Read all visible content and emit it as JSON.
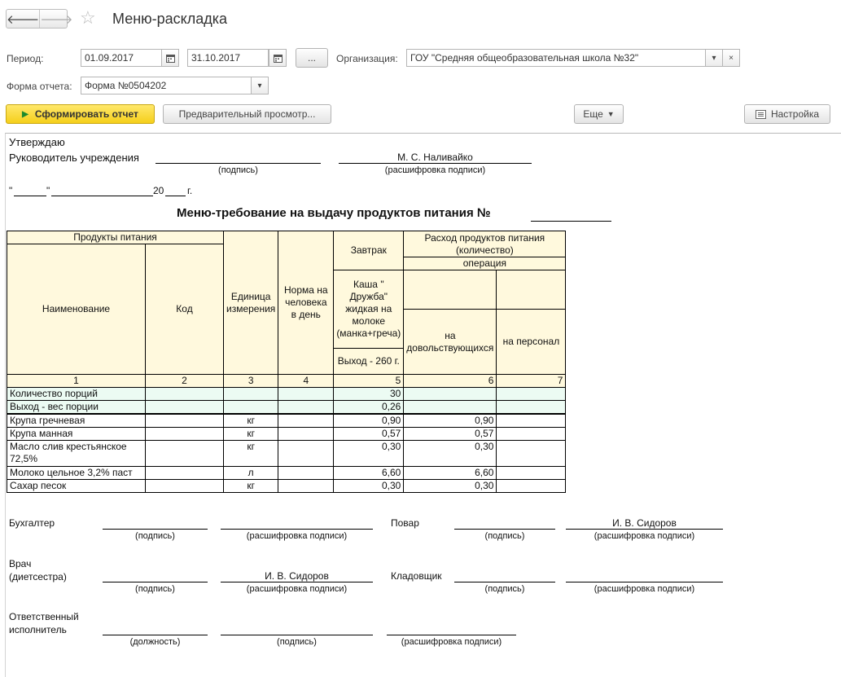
{
  "window": {
    "title": "Меню-раскладка"
  },
  "icons": {
    "back": "arrow-left-icon",
    "forward": "arrow-right-icon",
    "favorite": "star-icon",
    "calendar": "calendar-icon",
    "dropdown": "chevron-down-icon",
    "clear": "close-icon",
    "settings": "settings-icon"
  },
  "form": {
    "period_label": "Период:",
    "date_from": "01.09.2017",
    "date_to": "31.10.2017",
    "period_button": "...",
    "org_label": "Организация:",
    "org_value": "ГОУ \"Средняя общеобразовательная школа №32\"",
    "form_label": "Форма отчета:",
    "form_value": "Форма №0504202"
  },
  "toolbar": {
    "generate": "Сформировать отчет",
    "preview": "Предварительный просмотр...",
    "more": "Еще",
    "settings": "Настройка"
  },
  "report": {
    "approve": "Утверждаю",
    "head_label": "Руководитель учреждения",
    "head_name": "М. С. Наливайко",
    "signature": "(подпись)",
    "signature_decode": "(расшифровка подписи)",
    "date_q1": "\"",
    "date_q2": "\"",
    "date_year": "20",
    "date_g": "г.",
    "title": "Меню-требование на выдачу продуктов питания №",
    "table": {
      "h_products": "Продукты питания",
      "h_name": "Наименование",
      "h_code": "Код",
      "h_unit": "Единица измерения",
      "h_norm": "Норма на человека в день",
      "h_breakfast": "Завтрак",
      "h_dish": "Каша \" Дружба\" жидкая на молоке (манка+греча)",
      "h_yield": "Выход - 260 г.",
      "h_consumption": "Расход продуктов питания (количество)",
      "h_operation": "операция",
      "h_students": "на довольствующихся",
      "h_staff": "на персонал",
      "col_numbers": [
        "1",
        "2",
        "3",
        "4",
        "5",
        "6",
        "7"
      ],
      "summary_rows": [
        {
          "name": "Количество порций",
          "qty": "30"
        },
        {
          "name": "Выход - вес порции",
          "qty": "0,26"
        }
      ],
      "rows": [
        {
          "name": "Крупа гречневая",
          "unit": "кг",
          "qty": "0,90",
          "students": "0,90"
        },
        {
          "name": "Крупа манная",
          "unit": "кг",
          "qty": "0,57",
          "students": "0,57"
        },
        {
          "name": "Масло слив крестьянское 72,5%",
          "unit": "кг",
          "qty": "0,30",
          "students": "0,30"
        },
        {
          "name": "Молоко цельное 3,2% паст",
          "unit": "л",
          "qty": "6,60",
          "students": "6,60"
        },
        {
          "name": "Сахар песок",
          "unit": "кг",
          "qty": "0,30",
          "students": "0,30"
        }
      ]
    },
    "accountant": "Бухгалтер",
    "cook": "Повар",
    "cook_name": "И. В. Сидоров",
    "doctor": "Врач\n(диетсестра)",
    "doctor_name": "И. В. Сидоров",
    "storekeeper": "Кладовщик",
    "responsible": "Ответственный\nисполнитель",
    "position": "(должность)"
  }
}
